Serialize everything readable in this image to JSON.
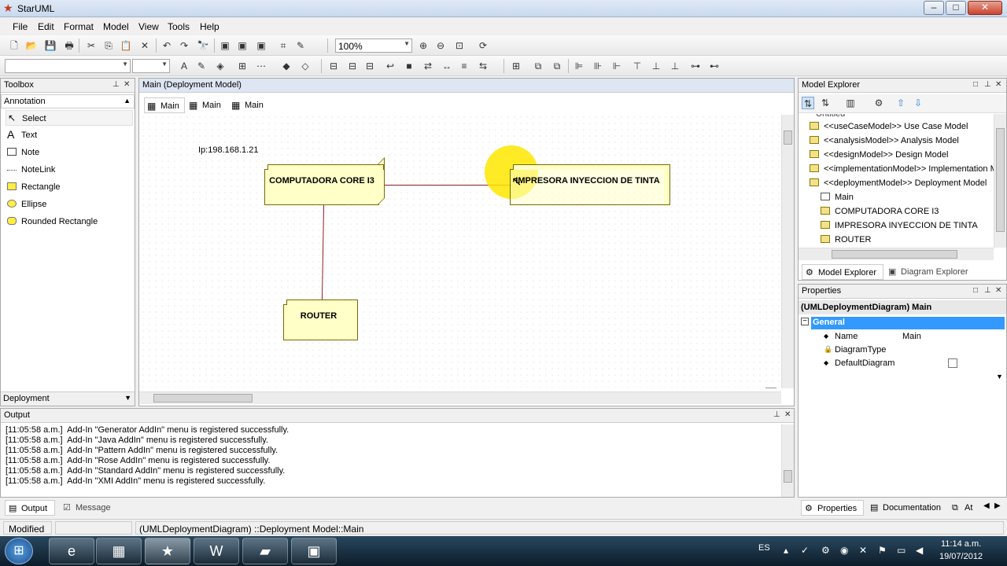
{
  "window": {
    "title": "StarUML",
    "minimize": "–",
    "maximize": "□",
    "close": "✕"
  },
  "menu": [
    "File",
    "Edit",
    "Format",
    "Model",
    "View",
    "Tools",
    "Help"
  ],
  "toolbar": {
    "zoom": "100%"
  },
  "toolbox": {
    "title": "Toolbox",
    "section": "Annotation",
    "items": [
      {
        "label": "Select",
        "icon": "cursor-icon"
      },
      {
        "label": "Text",
        "icon": "text-icon"
      },
      {
        "label": "Note",
        "icon": "note-icon"
      },
      {
        "label": "NoteLink",
        "icon": "notelink-icon"
      },
      {
        "label": "Rectangle",
        "icon": "rectangle-icon"
      },
      {
        "label": "Ellipse",
        "icon": "ellipse-icon"
      },
      {
        "label": "Rounded Rectangle",
        "icon": "rounded-rectangle-icon"
      }
    ],
    "footer": "Deployment"
  },
  "diagram": {
    "title": "Main (Deployment Model)",
    "tabs": [
      "Main",
      "Main",
      "Main"
    ],
    "annotation": "Ip:198.168.1.21",
    "nodes": {
      "computer": "COMPUTADORA CORE I3",
      "printer": "IMPRESORA INYECCION DE TINTA",
      "router": "ROUTER"
    }
  },
  "output": {
    "title": "Output",
    "lines": [
      {
        "time": "[11:05:58 a.m.]",
        "msg": "Add-In \"Generator AddIn\" menu is registered successfully."
      },
      {
        "time": "[11:05:58 a.m.]",
        "msg": "Add-In \"Java AddIn\" menu is registered successfully."
      },
      {
        "time": "[11:05:58 a.m.]",
        "msg": "Add-In \"Pattern AddIn\" menu is registered successfully."
      },
      {
        "time": "[11:05:58 a.m.]",
        "msg": "Add-In \"Rose AddIn\" menu is registered successfully."
      },
      {
        "time": "[11:05:58 a.m.]",
        "msg": "Add-In \"Standard AddIn\" menu is registered successfully."
      },
      {
        "time": "[11:05:58 a.m.]",
        "msg": "Add-In \"XMI AddIn\" menu is registered successfully."
      }
    ],
    "tabs": [
      "Output",
      "Message"
    ]
  },
  "explorer": {
    "title": "Model Explorer",
    "root": "Untitled",
    "items": [
      "<<useCaseModel>> Use Case Model",
      "<<analysisModel>> Analysis Model",
      "<<designModel>> Design Model",
      "<<implementationModel>> Implementation M",
      "<<deploymentModel>> Deployment Model"
    ],
    "children": [
      "Main",
      "COMPUTADORA CORE I3",
      "IMPRESORA INYECCION DE TINTA",
      "ROUTER"
    ],
    "tabs": [
      "Model Explorer",
      "Diagram Explorer"
    ]
  },
  "properties": {
    "title": "Properties",
    "header": "(UMLDeploymentDiagram) Main",
    "group": "General",
    "rows": [
      {
        "name": "Name",
        "value": "Main"
      },
      {
        "name": "DiagramType",
        "value": ""
      },
      {
        "name": "DefaultDiagram",
        "value": ""
      }
    ],
    "tabs": [
      "Properties",
      "Documentation",
      "At"
    ]
  },
  "status": {
    "state": "Modified",
    "path": "(UMLDeploymentDiagram) ::Deployment Model::Main"
  },
  "taskbar": {
    "lang": "ES",
    "time": "11:14 a.m.",
    "date": "19/07/2012"
  }
}
